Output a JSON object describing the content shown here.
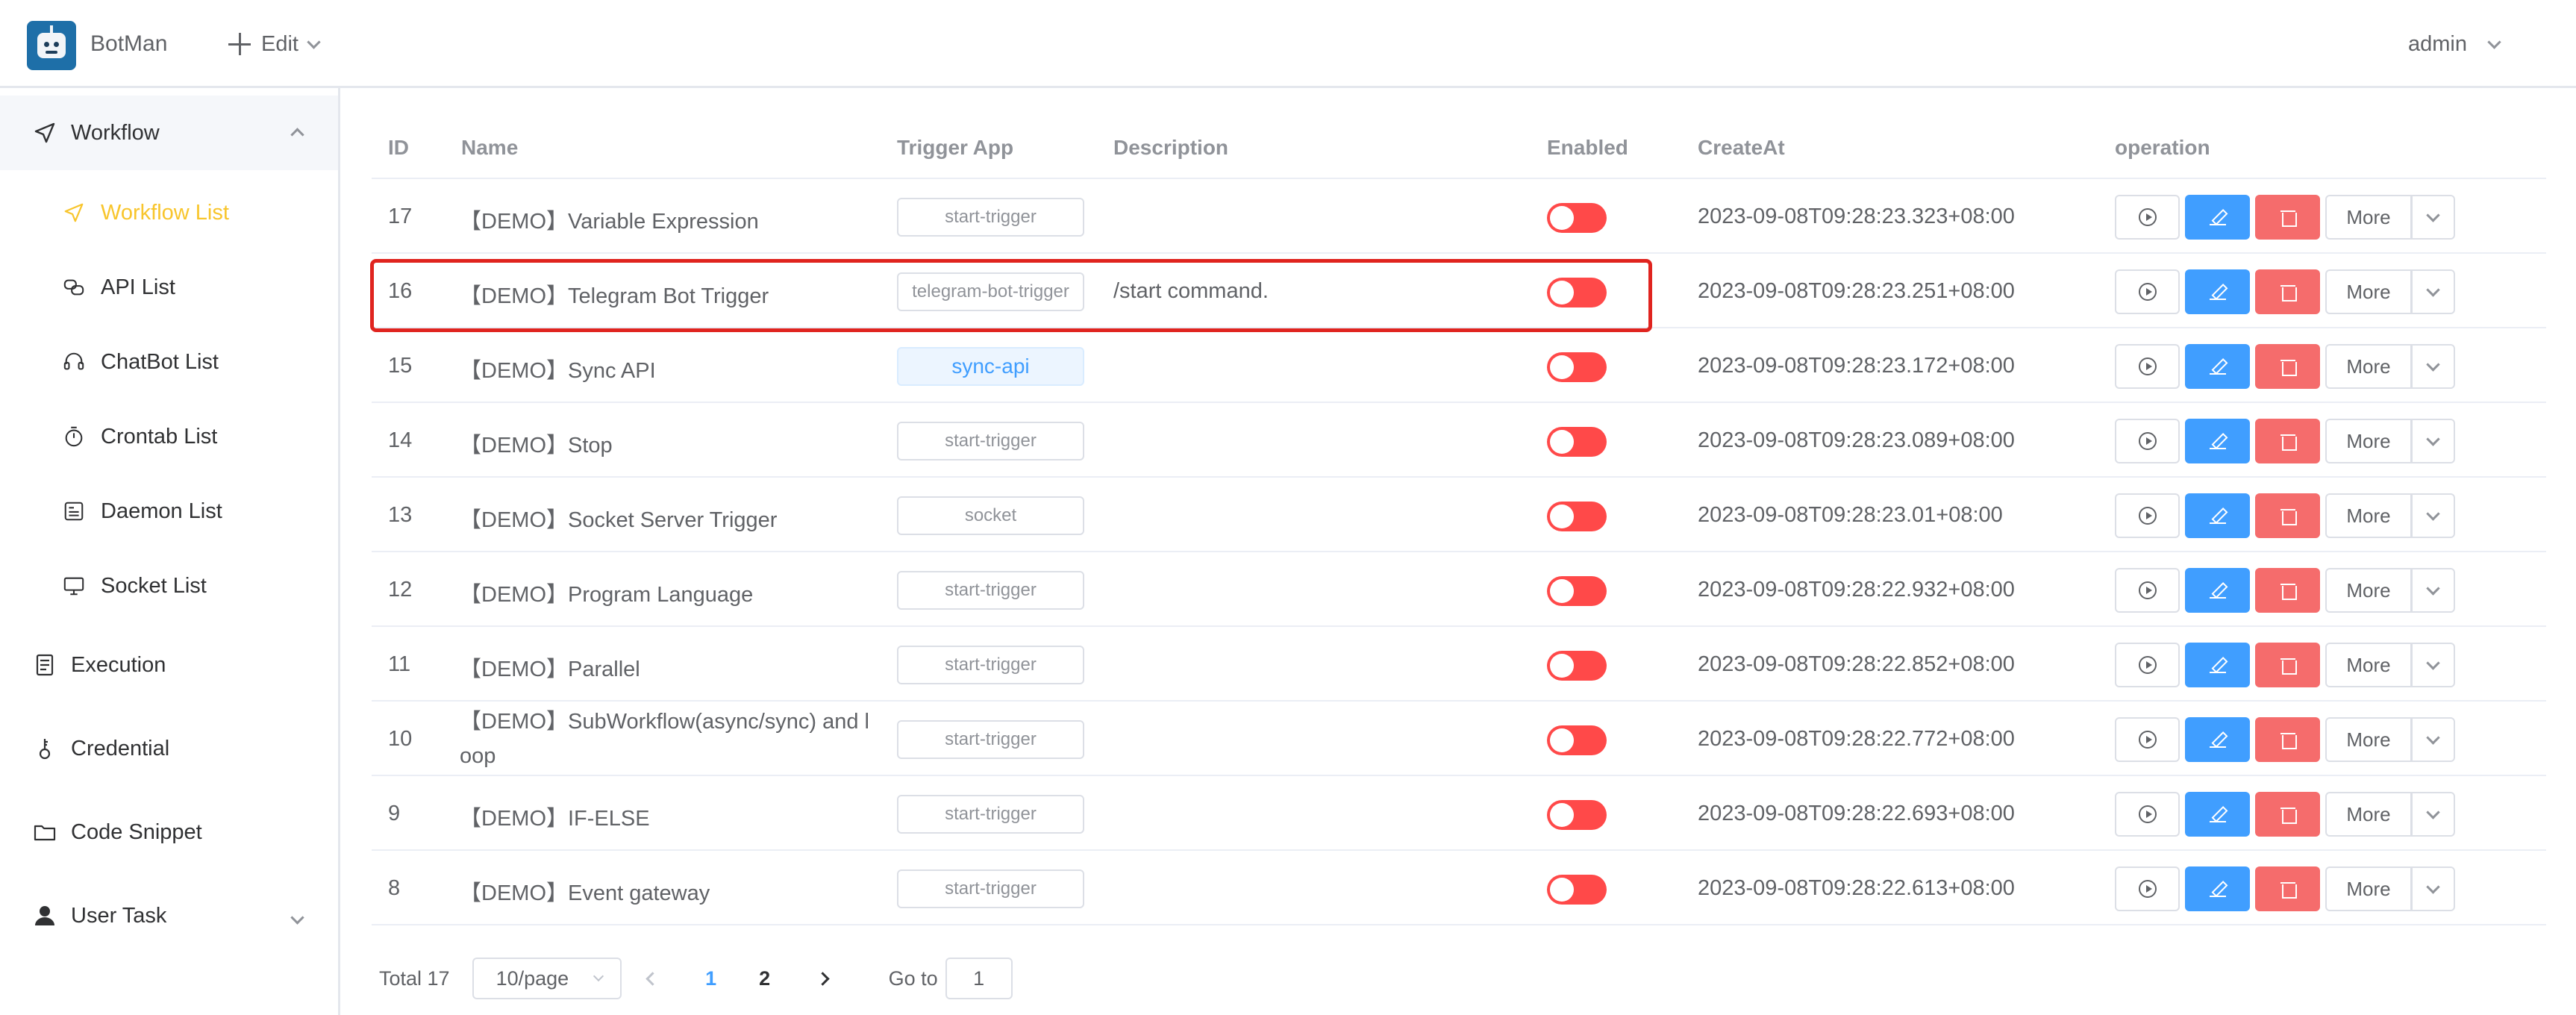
{
  "header": {
    "app_title": "BotMan",
    "edit_label": "Edit",
    "user_label": "admin"
  },
  "sidebar": {
    "items": [
      {
        "label": "Workflow",
        "icon": "paper-plane-icon"
      },
      {
        "label": "Workflow List",
        "icon": "paper-plane-icon",
        "active": true
      },
      {
        "label": "API List",
        "icon": "link-icon"
      },
      {
        "label": "ChatBot List",
        "icon": "headset-icon"
      },
      {
        "label": "Crontab List",
        "icon": "stopwatch-icon"
      },
      {
        "label": "Daemon List",
        "icon": "tray-icon"
      },
      {
        "label": "Socket List",
        "icon": "monitor-icon"
      },
      {
        "label": "Execution",
        "icon": "document-icon"
      },
      {
        "label": "Credential",
        "icon": "key-icon"
      },
      {
        "label": "Code Snippet",
        "icon": "folder-icon"
      },
      {
        "label": "User Task",
        "icon": "user-icon"
      }
    ]
  },
  "table": {
    "headers": {
      "id": "ID",
      "name": "Name",
      "trigger": "Trigger App",
      "description": "Description",
      "enabled": "Enabled",
      "create": "CreateAt",
      "operation": "operation"
    },
    "more_label": "More",
    "rows": [
      {
        "id": "17",
        "name": "【DEMO】Variable Expression",
        "trigger": "start-trigger",
        "description": "",
        "enabled": false,
        "create": "2023-09-08T09:28:23.323+08:00"
      },
      {
        "id": "16",
        "name": "【DEMO】Telegram Bot Trigger",
        "trigger": "telegram-bot-trigger",
        "description": "/start command.",
        "enabled": false,
        "create": "2023-09-08T09:28:23.251+08:00"
      },
      {
        "id": "15",
        "name": "【DEMO】Sync API",
        "trigger": "sync-api",
        "description": "",
        "enabled": false,
        "create": "2023-09-08T09:28:23.172+08:00"
      },
      {
        "id": "14",
        "name": "【DEMO】Stop",
        "trigger": "start-trigger",
        "description": "",
        "enabled": false,
        "create": "2023-09-08T09:28:23.089+08:00"
      },
      {
        "id": "13",
        "name": "【DEMO】Socket Server Trigger",
        "trigger": "socket",
        "description": "",
        "enabled": false,
        "create": "2023-09-08T09:28:23.01+08:00"
      },
      {
        "id": "12",
        "name": "【DEMO】Program Language",
        "trigger": "start-trigger",
        "description": "",
        "enabled": false,
        "create": "2023-09-08T09:28:22.932+08:00"
      },
      {
        "id": "11",
        "name": "【DEMO】Parallel",
        "trigger": "start-trigger",
        "description": "",
        "enabled": false,
        "create": "2023-09-08T09:28:22.852+08:00"
      },
      {
        "id": "10",
        "name": "【DEMO】SubWorkflow(async/sync) and l oop",
        "trigger": "start-trigger",
        "description": "",
        "enabled": false,
        "create": "2023-09-08T09:28:22.772+08:00"
      },
      {
        "id": "9",
        "name": "【DEMO】IF-ELSE",
        "trigger": "start-trigger",
        "description": "",
        "enabled": false,
        "create": "2023-09-08T09:28:22.693+08:00"
      },
      {
        "id": "8",
        "name": "【DEMO】Event gateway",
        "trigger": "start-trigger",
        "description": "",
        "enabled": false,
        "create": "2023-09-08T09:28:22.613+08:00"
      }
    ]
  },
  "pagination": {
    "total": "Total 17",
    "page_size": "10/page",
    "pages": [
      "1",
      "2"
    ],
    "current": "1",
    "goto_label": "Go to",
    "goto_value": "1"
  },
  "colors": {
    "accent": "#409eff",
    "active_nav": "#f8c52c",
    "danger": "#f56c6c",
    "switch_off": "#ff4949",
    "highlight_box": "#e0241f"
  }
}
